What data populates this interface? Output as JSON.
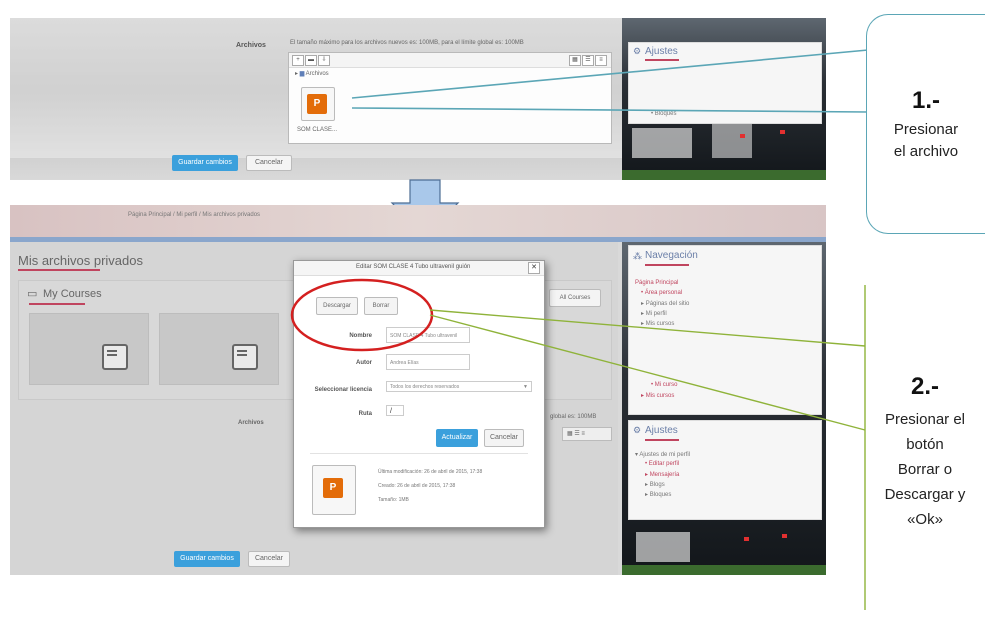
{
  "colors": {
    "accent_blue": "#3ba0dc",
    "accent_red": "#c0455f",
    "callout_border_1": "#5ba6b6",
    "callout_line_2": "#8fb33a",
    "highlight_circle": "#d42020",
    "arrow_fill": "#a9c8ea"
  },
  "top_shot": {
    "files_label": "Archivos",
    "size_note": "El tamaño máximo para los archivos nuevos es: 100MB, para el límite global es: 100MB",
    "folder_label": "Archivos",
    "file_name": "SOM CLASE...",
    "save_button": "Guardar cambios",
    "cancel_button": "Cancelar",
    "settings_block_title": "Ajustes",
    "settings_item": "Bloques"
  },
  "bottom_shot": {
    "breadcrumb": "Página Principal / Mi perfil / Mis archivos privados",
    "page_title": "Mis archivos privados",
    "courses_title": "My Courses",
    "all_courses_button": "All Courses",
    "files_label": "Archivos",
    "size_note_tail": "global es: 100MB",
    "save_button": "Guardar cambios",
    "cancel_button": "Cancelar",
    "navigation": {
      "title": "Navegación",
      "items": [
        "Página Principal",
        "Área personal",
        "Páginas del sitio",
        "Mi perfil",
        "Mis cursos",
        "Mis cursos"
      ],
      "extra_item": "Mi curso"
    },
    "settings": {
      "title": "Ajustes",
      "items": [
        "Ajustes de mi perfil",
        "Editar perfil",
        "Mensajería",
        "Blogs",
        "Bloques"
      ]
    },
    "modal": {
      "title": "Editar SOM CLASE 4 Tubo ultravenil guión",
      "close": "✕",
      "download_button": "Descargar",
      "delete_button": "Borrar",
      "name_label": "Nombre",
      "name_value": "SOM CLASE 4 Tubo ultravenil",
      "author_label": "Autor",
      "author_value": "Andrea Elías",
      "license_label": "Seleccionar licencia",
      "license_value": "Todos los derechos reservados",
      "path_label": "Ruta",
      "path_value": "/",
      "update_button": "Actualizar",
      "cancel_button": "Cancelar",
      "meta_modified": "Última modificación: 26 de abril de 2015, 17:38",
      "meta_created": "Creado: 26 de abril de 2015, 17:38",
      "meta_size": "Tamaño: 1MB"
    }
  },
  "callout_1": {
    "number": "1.-",
    "line1": "Presionar",
    "line2": "el archivo"
  },
  "callout_2": {
    "number": "2.-",
    "lines": [
      "Presionar el",
      "botón",
      "Borrar o",
      "Descargar y",
      "«Ok»"
    ]
  }
}
